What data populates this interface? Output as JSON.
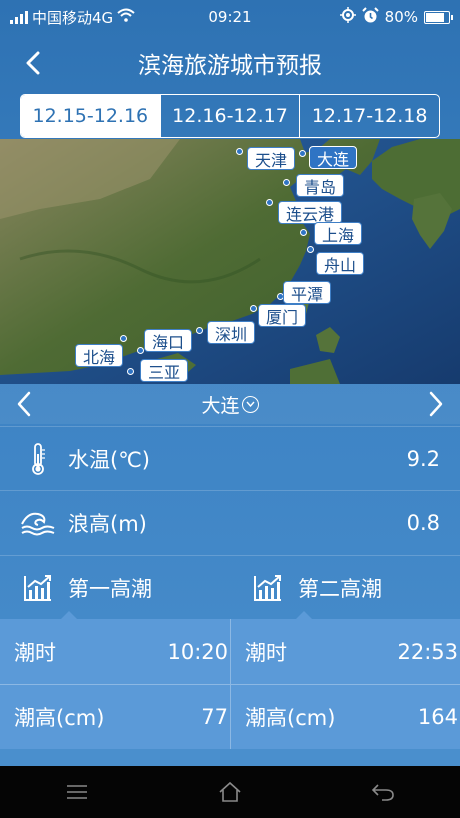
{
  "status": {
    "carrier": "中国移动4G",
    "time": "09:21",
    "battery": "80%",
    "battery_level": 0.8
  },
  "header": {
    "title": "滨海旅游城市预报"
  },
  "tabs": [
    {
      "label": "12.15-12.16",
      "active": true
    },
    {
      "label": "12.16-12.17",
      "active": false
    },
    {
      "label": "12.17-12.18",
      "active": false
    }
  ],
  "map": {
    "cities": [
      "天津",
      "大连",
      "青岛",
      "连云港",
      "上海",
      "舟山",
      "平潭",
      "厦门",
      "深圳",
      "海口",
      "北海",
      "三亚"
    ],
    "selected": "大连"
  },
  "selector": {
    "city": "大连"
  },
  "water_temp": {
    "label": "水温(℃)",
    "value": "9.2"
  },
  "wave_height": {
    "label": "浪高(m)",
    "value": "0.8"
  },
  "tides": [
    {
      "title": "第一高潮",
      "time_label": "潮时",
      "time": "10:20",
      "height_label": "潮高(cm)",
      "height": "77"
    },
    {
      "title": "第二高潮",
      "time_label": "潮时",
      "time": "22:53",
      "height_label": "潮高(cm)",
      "height": "164"
    }
  ]
}
